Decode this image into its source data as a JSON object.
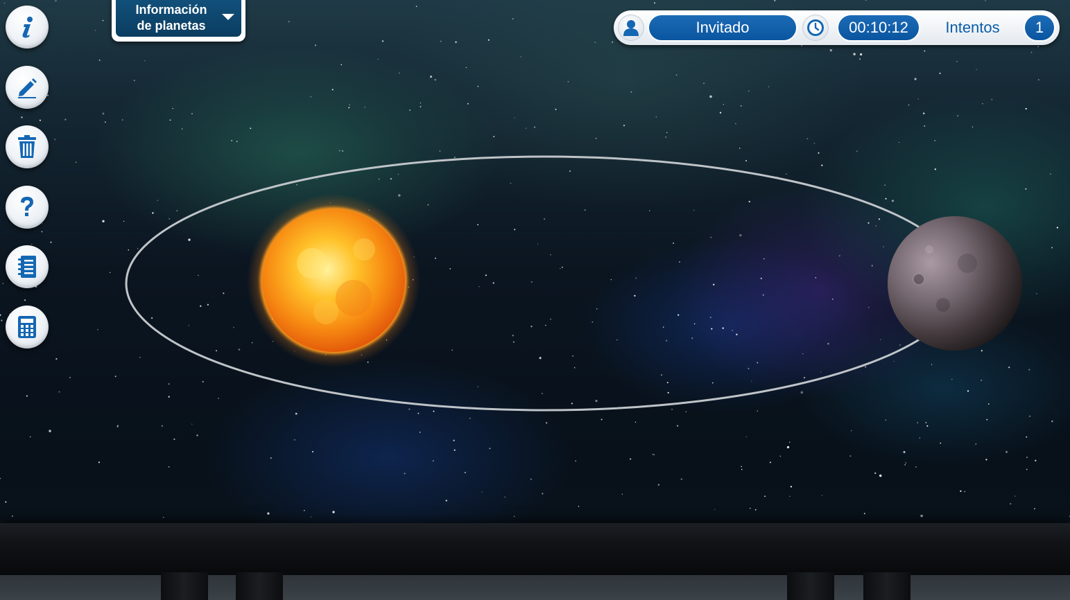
{
  "planet_info_dropdown": {
    "line1": "Información",
    "line2": "de planetas"
  },
  "status_bar": {
    "user_name": "Invitado",
    "timer": "00:10:12",
    "attempts_label": "Intentos",
    "attempts_value": "1"
  },
  "toolbar": [
    {
      "name": "info-button",
      "icon": "info-icon"
    },
    {
      "name": "edit-button",
      "icon": "pencil-icon"
    },
    {
      "name": "delete-button",
      "icon": "trash-icon"
    },
    {
      "name": "help-button",
      "icon": "question-icon"
    },
    {
      "name": "notes-button",
      "icon": "notebook-icon"
    },
    {
      "name": "calculator-button",
      "icon": "calculator-icon"
    }
  ],
  "scene": {
    "star": "sun",
    "planet": "rocky-planet",
    "orbit": "elliptical-orbit"
  },
  "colors": {
    "accent_blue": "#0a55a0",
    "dropdown_blue": "#0b3d61",
    "icon_blue": "#1467b3",
    "orbit_stroke": "#bfc4c8"
  }
}
